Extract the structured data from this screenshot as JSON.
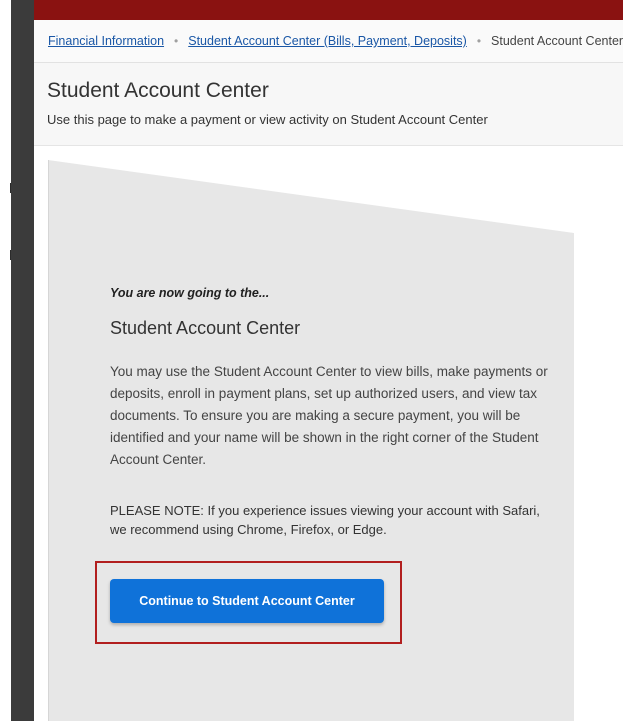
{
  "breadcrumb": {
    "items": [
      "Financial Information",
      "Student Account Center (Bills, Payment, Deposits)",
      "Student Account Center"
    ],
    "separator": "•"
  },
  "header": {
    "title": "Student Account Center",
    "subtitle": "Use this page to make a payment or view activity on Student Account Center"
  },
  "card": {
    "intro": "You are now going to the...",
    "title": "Student Account Center",
    "description": "You may use the Student Account Center to view bills, make payments or deposits, enroll in payment plans, set up authorized users, and view tax documents. To ensure you are making a secure payment, you will be identified and your name will be shown in the right corner of the Student Account Center.",
    "note": "PLEASE NOTE: If you experience issues viewing your account with Safari, we recommend using Chrome, Firefox, or Edge.",
    "button_label": "Continue to Student Account Center"
  },
  "colors": {
    "topbar": "#8a1211",
    "link": "#1a57a6",
    "button": "#0f72d9",
    "highlight_border": "#b21f1f",
    "panel": "#e7e7e7"
  }
}
